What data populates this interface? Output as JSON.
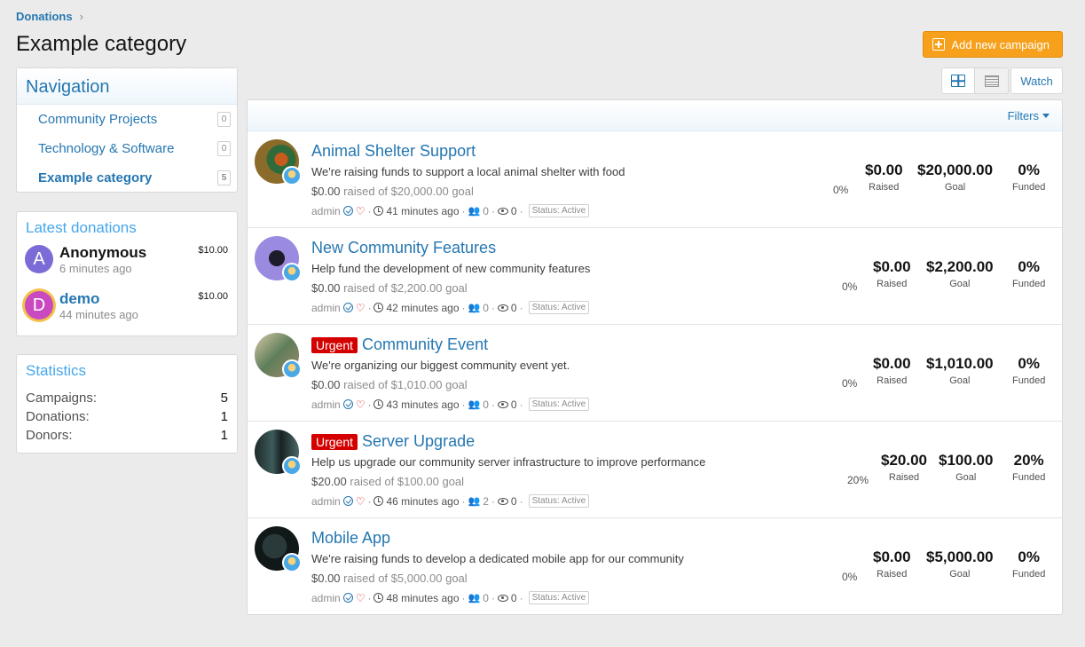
{
  "breadcrumb": {
    "label": "Donations"
  },
  "page_title": "Example category",
  "add_campaign_label": "Add new campaign",
  "watch_label": "Watch",
  "filters_label": "Filters",
  "navigation": {
    "title": "Navigation",
    "items": [
      {
        "label": "Community Projects",
        "count": "0"
      },
      {
        "label": "Technology & Software",
        "count": "0"
      },
      {
        "label": "Example category",
        "count": "5"
      }
    ]
  },
  "latest_donations": {
    "title": "Latest donations",
    "items": [
      {
        "initial": "A",
        "name": "Anonymous",
        "time": "6 minutes ago",
        "amount": "$10.00"
      },
      {
        "initial": "D",
        "name": "demo",
        "time": "44 minutes ago",
        "amount": "$10.00"
      }
    ]
  },
  "statistics": {
    "title": "Statistics",
    "rows": [
      {
        "label": "Campaigns:",
        "value": "5"
      },
      {
        "label": "Donations:",
        "value": "1"
      },
      {
        "label": "Donors:",
        "value": "1"
      }
    ]
  },
  "labels": {
    "raised": "Raised",
    "goal": "Goal",
    "funded": "Funded",
    "urgent": "Urgent",
    "status": "Status: Active",
    "author": "admin"
  },
  "campaigns": [
    {
      "title": "Animal Shelter Support",
      "urgent": false,
      "desc": "We're raising funds to support a local animal shelter with food",
      "raised": "$0.00",
      "raised_text": "raised of $20,000.00 goal",
      "time": "41 minutes ago",
      "donors": "0",
      "views": "0",
      "pct": "0%",
      "goal": "$20,000.00",
      "funded": "0%"
    },
    {
      "title": "New Community Features",
      "urgent": false,
      "desc": "Help fund the development of new community features",
      "raised": "$0.00",
      "raised_text": "raised of $2,200.00 goal",
      "time": "42 minutes ago",
      "donors": "0",
      "views": "0",
      "pct": "0%",
      "goal": "$2,200.00",
      "funded": "0%"
    },
    {
      "title": "Community Event",
      "urgent": true,
      "desc": "We're organizing our biggest community event yet.",
      "raised": "$0.00",
      "raised_text": "raised of $1,010.00 goal",
      "time": "43 minutes ago",
      "donors": "0",
      "views": "0",
      "pct": "0%",
      "goal": "$1,010.00",
      "funded": "0%"
    },
    {
      "title": "Server Upgrade",
      "urgent": true,
      "desc": "Help us upgrade our community server infrastructure to improve performance",
      "raised": "$20.00",
      "raised_text": "raised of $100.00 goal",
      "time": "46 minutes ago",
      "donors": "2",
      "views": "0",
      "pct": "20%",
      "goal": "$100.00",
      "funded": "20%"
    },
    {
      "title": "Mobile App",
      "urgent": false,
      "desc": "We're raising funds to develop a dedicated mobile app for our community",
      "raised": "$0.00",
      "raised_text": "raised of $5,000.00 goal",
      "time": "48 minutes ago",
      "donors": "0",
      "views": "0",
      "pct": "0%",
      "goal": "$5,000.00",
      "funded": "0%"
    }
  ]
}
